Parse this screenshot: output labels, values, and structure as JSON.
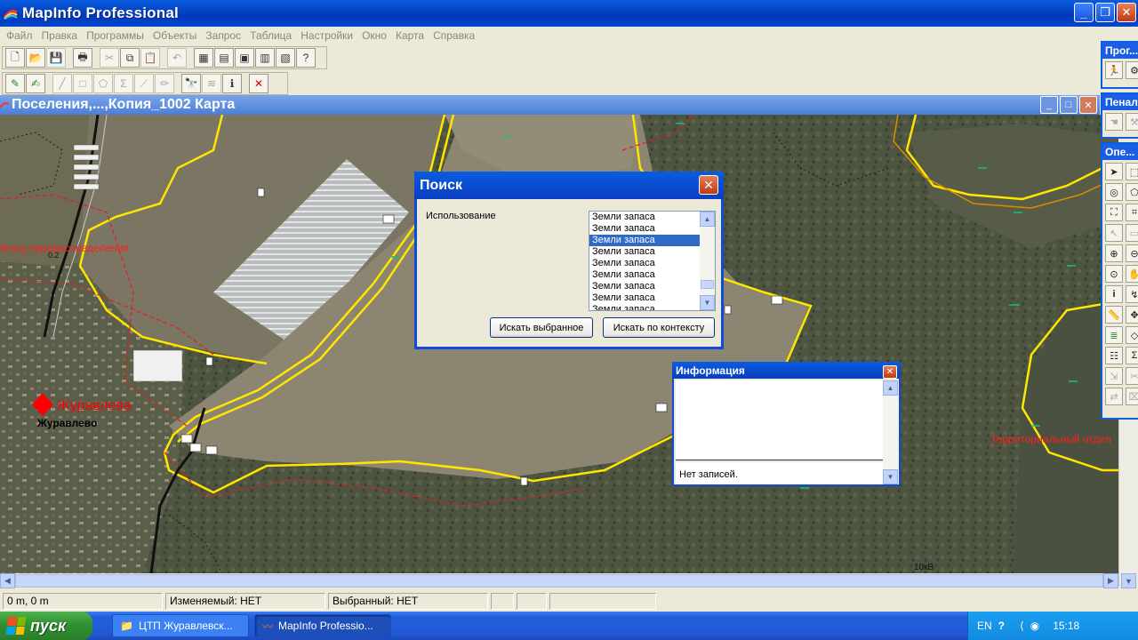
{
  "app": {
    "title": "MapInfo Professional"
  },
  "menu": [
    "Файл",
    "Правка",
    "Программы",
    "Объекты",
    "Запрос",
    "Таблица",
    "Настройки",
    "Окно",
    "Карта",
    "Справка"
  ],
  "map_window": {
    "title": "Поселения,...,Копия_1002 Карта",
    "labels": {
      "redistribution": "Фонд перераспределения",
      "zhuravleva": "Журавлева",
      "zhuravlevo": "Журавлево",
      "territorial": "Территориальный отдел",
      "small_1": "0.2",
      "kv": "10кВ"
    }
  },
  "right_panels": [
    {
      "title": "Прог...",
      "icons": [
        "runner-icon",
        "tool-icon"
      ]
    },
    {
      "title": "Пенал",
      "icons": [
        "hand-icon",
        "wrench-icon"
      ]
    },
    {
      "title": "Опе...",
      "icons": [
        "select-arrow-icon",
        "marquee-icon",
        "radius-select-icon",
        "polygon-select-icon",
        "boundary-select-icon",
        "label-icon",
        "select-icon",
        "info-icon",
        "zoom-in-icon",
        "zoom-out-icon",
        "grabber-icon",
        "info-tool-icon",
        "ruler-icon",
        "layer-control-icon",
        "legend-icon",
        "statistics-icon",
        "scale-icon",
        "clip-icon",
        "reshape-icon",
        "move-icon"
      ]
    }
  ],
  "search_dialog": {
    "title": "Поиск",
    "field_label": "Использование",
    "list_items": [
      "Земли запаса",
      "Земли запаса",
      "Земли запаса",
      "Земли запаса",
      "Земли запаса",
      "Земли запаса",
      "Земли запаса",
      "Земли запаса",
      "Земли запаса"
    ],
    "selected_index": 2,
    "btn_selected": "Искать выбранное",
    "btn_context": "Искать по контексту"
  },
  "info_window": {
    "title": "Информация",
    "status": "Нет записей."
  },
  "statusbar": {
    "coords": "0 m, 0 m",
    "editable": "Изменяемый: НЕТ",
    "selected": "Выбранный: НЕТ"
  },
  "taskbar": {
    "start": "пуск",
    "tasks": [
      "ЦТП Журавлевск...",
      "MapInfo Professio..."
    ],
    "lang": "EN",
    "time": "15:18"
  },
  "colors": {
    "title_blue": "#0a5ce0",
    "selection": "#316ac5",
    "boundary_yellow": "#ffe600",
    "map_red": "#e02020"
  }
}
